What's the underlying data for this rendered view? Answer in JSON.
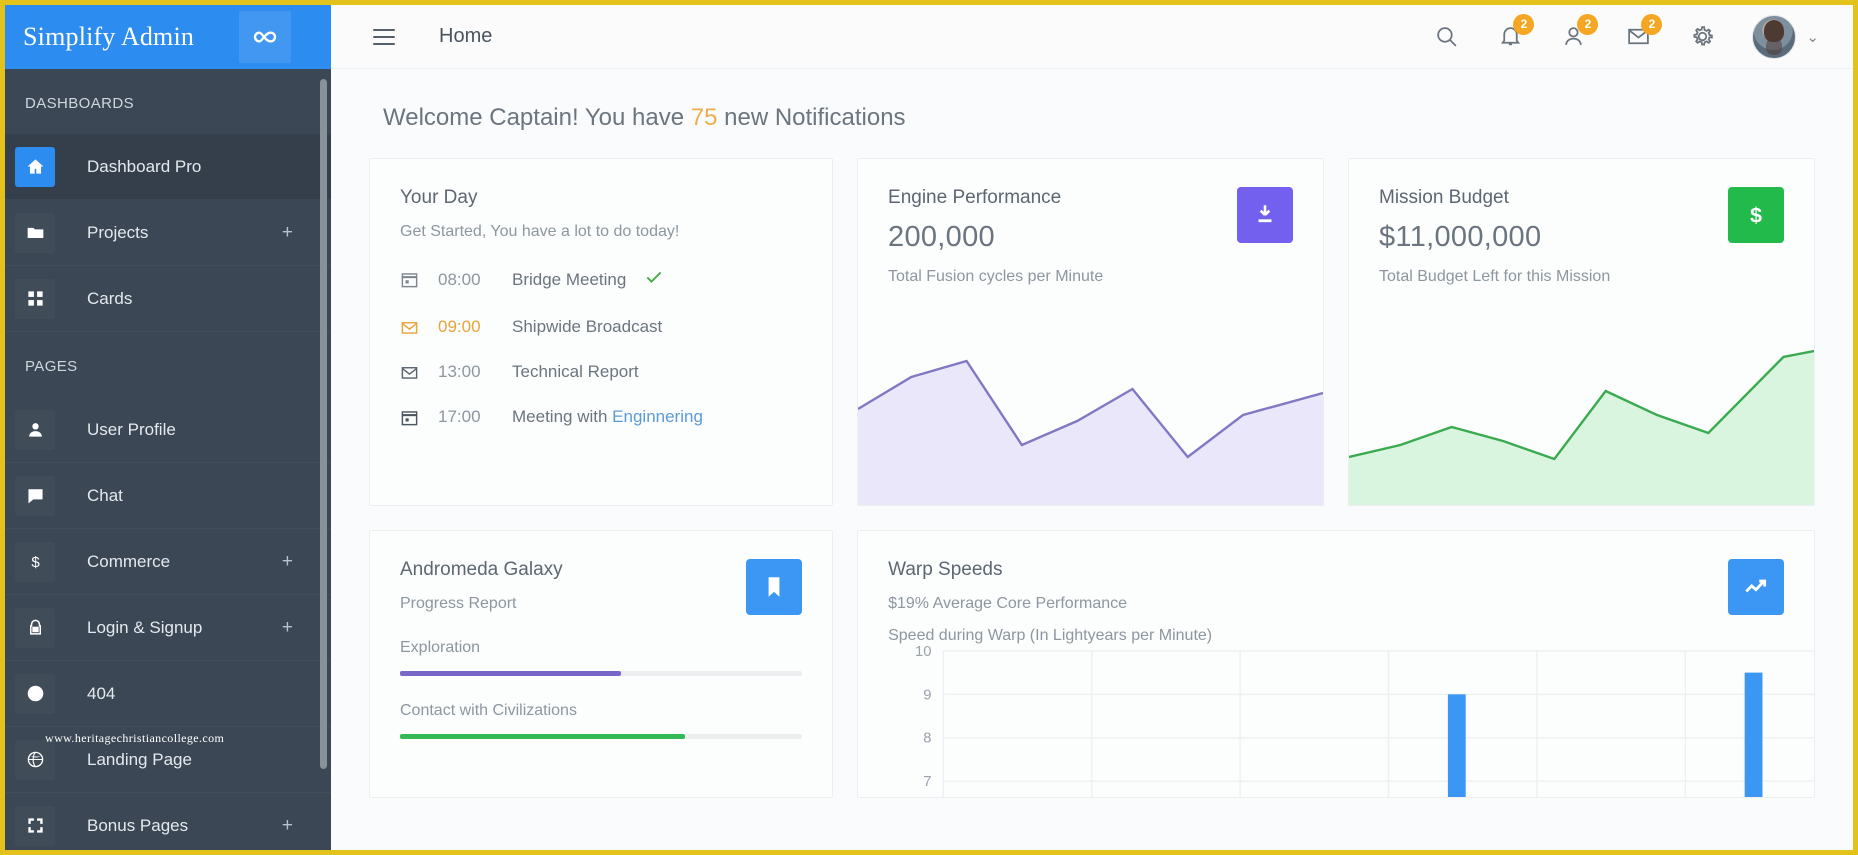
{
  "brand": {
    "name": "Simplify Admin",
    "logo_icon": "infinity-icon"
  },
  "sidebar": {
    "sections": [
      {
        "label": "DASHBOARDS"
      },
      {
        "label": "PAGES"
      }
    ],
    "items_dashboards": [
      {
        "label": "Dashboard Pro",
        "icon": "home-icon",
        "active": true,
        "expandable": false
      },
      {
        "label": "Projects",
        "icon": "folder-icon",
        "active": false,
        "expandable": true,
        "expand_glyph": "+"
      },
      {
        "label": "Cards",
        "icon": "grid-icon",
        "active": false,
        "expandable": false
      }
    ],
    "items_pages": [
      {
        "label": "User Profile",
        "icon": "person-icon",
        "active": false,
        "expandable": false
      },
      {
        "label": "Chat",
        "icon": "chat-icon",
        "active": false,
        "expandable": false
      },
      {
        "label": "Commerce",
        "icon": "dollar-icon",
        "active": false,
        "expandable": true,
        "expand_glyph": "+"
      },
      {
        "label": "Login & Signup",
        "icon": "lock-icon",
        "active": false,
        "expandable": true,
        "expand_glyph": "+"
      },
      {
        "label": "404",
        "icon": "alert-circle-icon",
        "active": false,
        "expandable": false
      },
      {
        "label": "Landing Page",
        "icon": "globe-icon",
        "active": false,
        "expandable": false
      },
      {
        "label": "Bonus Pages",
        "icon": "expand-icon",
        "active": false,
        "expandable": true,
        "expand_glyph": "+"
      }
    ]
  },
  "watermark": {
    "text": "www.heritagechristiancollege.com"
  },
  "header": {
    "title": "Home",
    "menu_icon": "hamburger-icon",
    "icons": [
      {
        "name": "search-icon",
        "badge": null
      },
      {
        "name": "bell-icon",
        "badge": "2"
      },
      {
        "name": "person-add-icon",
        "badge": "2"
      },
      {
        "name": "envelope-icon",
        "badge": "2"
      },
      {
        "name": "gear-icon",
        "badge": null
      }
    ],
    "avatar_chevron": "⌄"
  },
  "welcome": {
    "prefix": "Welcome Captain! You have ",
    "count": "75",
    "suffix": " new Notifications"
  },
  "cards": {
    "your_day": {
      "title": "Your Day",
      "subtitle": "Get Started, You have a lot to do today!",
      "agenda": [
        {
          "icon": "calendar-icon",
          "time": "08:00",
          "text": "Bridge Meeting",
          "link": "",
          "done": true,
          "highlight": false
        },
        {
          "icon": "envelope-icon",
          "time": "09:00",
          "text": "Shipwide Broadcast",
          "link": "",
          "done": false,
          "highlight": true
        },
        {
          "icon": "envelope-icon",
          "time": "13:00",
          "text": "Technical Report",
          "link": "",
          "done": false,
          "highlight": false
        },
        {
          "icon": "calendar-icon",
          "time": "17:00",
          "text": "Meeting with ",
          "link": "Enginnering",
          "done": false,
          "highlight": false
        }
      ]
    },
    "engine": {
      "title": "Engine Performance",
      "value": "200,000",
      "subtitle": "Total Fusion cycles per Minute",
      "action_icon": "download-icon",
      "accent": "#7460ee"
    },
    "budget": {
      "title": "Mission Budget",
      "value": "$11,000,000",
      "subtitle": "Total Budget Left for this Mission",
      "action_icon": "dollar-icon",
      "accent": "#22bb4b"
    },
    "andromeda": {
      "title": "Andromeda Galaxy",
      "subtitle": "Progress Report",
      "action_icon": "bookmark-icon",
      "accent": "#3b97f3",
      "bars": [
        {
          "label": "Exploration",
          "percent": 55,
          "color": "#7866c9"
        },
        {
          "label": "Contact with Civilizations",
          "percent": 71,
          "color": "#33b956"
        }
      ]
    },
    "warp": {
      "title": "Warp Speeds",
      "subtitle": "$19% Average Core Performance",
      "caption": "Speed during Warp (In Lightyears per Minute)",
      "action_icon": "trending-up-icon",
      "accent": "#3b97f3"
    }
  },
  "chart_data": [
    {
      "type": "area",
      "name": "engine-performance-sparkline",
      "title": "Engine Performance",
      "ylabel": "Total Fusion cycles per Minute",
      "xlabel": "",
      "x": [
        0,
        1,
        2,
        3,
        4,
        5,
        6
      ],
      "values": [
        62,
        82,
        96,
        40,
        54,
        74,
        28,
        58
      ],
      "line_color": "#8178c4",
      "fill_color": "#e8e6f8",
      "grid": false,
      "legend": null
    },
    {
      "type": "area",
      "name": "mission-budget-sparkline",
      "title": "Mission Budget",
      "ylabel": "Total Budget Left for this Mission",
      "xlabel": "",
      "x": [
        0,
        1,
        2,
        3,
        4,
        5,
        6,
        7
      ],
      "values": [
        22,
        36,
        44,
        30,
        22,
        66,
        48,
        38,
        84
      ],
      "line_color": "#3aaa4e",
      "fill_color": "#d8f5de",
      "grid": false,
      "legend": null
    },
    {
      "type": "bar",
      "name": "warp-speeds-bar-chart",
      "title": "Warp Speeds",
      "subtitle": "$19% Average Core Performance",
      "caption": "Speed during Warp (In Lightyears per Minute)",
      "xlabel": "",
      "ylabel": "",
      "ytick_labels": [
        "10",
        "9",
        "8",
        "7"
      ],
      "ytick_values": [
        10,
        9,
        8,
        7
      ],
      "ylim": [
        7,
        10
      ],
      "categories": [
        "1",
        "2",
        "3",
        "4",
        "5",
        "6",
        "7",
        "8"
      ],
      "values": [
        null,
        null,
        null,
        null,
        9.0,
        null,
        9.5,
        null
      ],
      "bar_color": "#3b97f3",
      "grid": true,
      "legend": null
    }
  ]
}
